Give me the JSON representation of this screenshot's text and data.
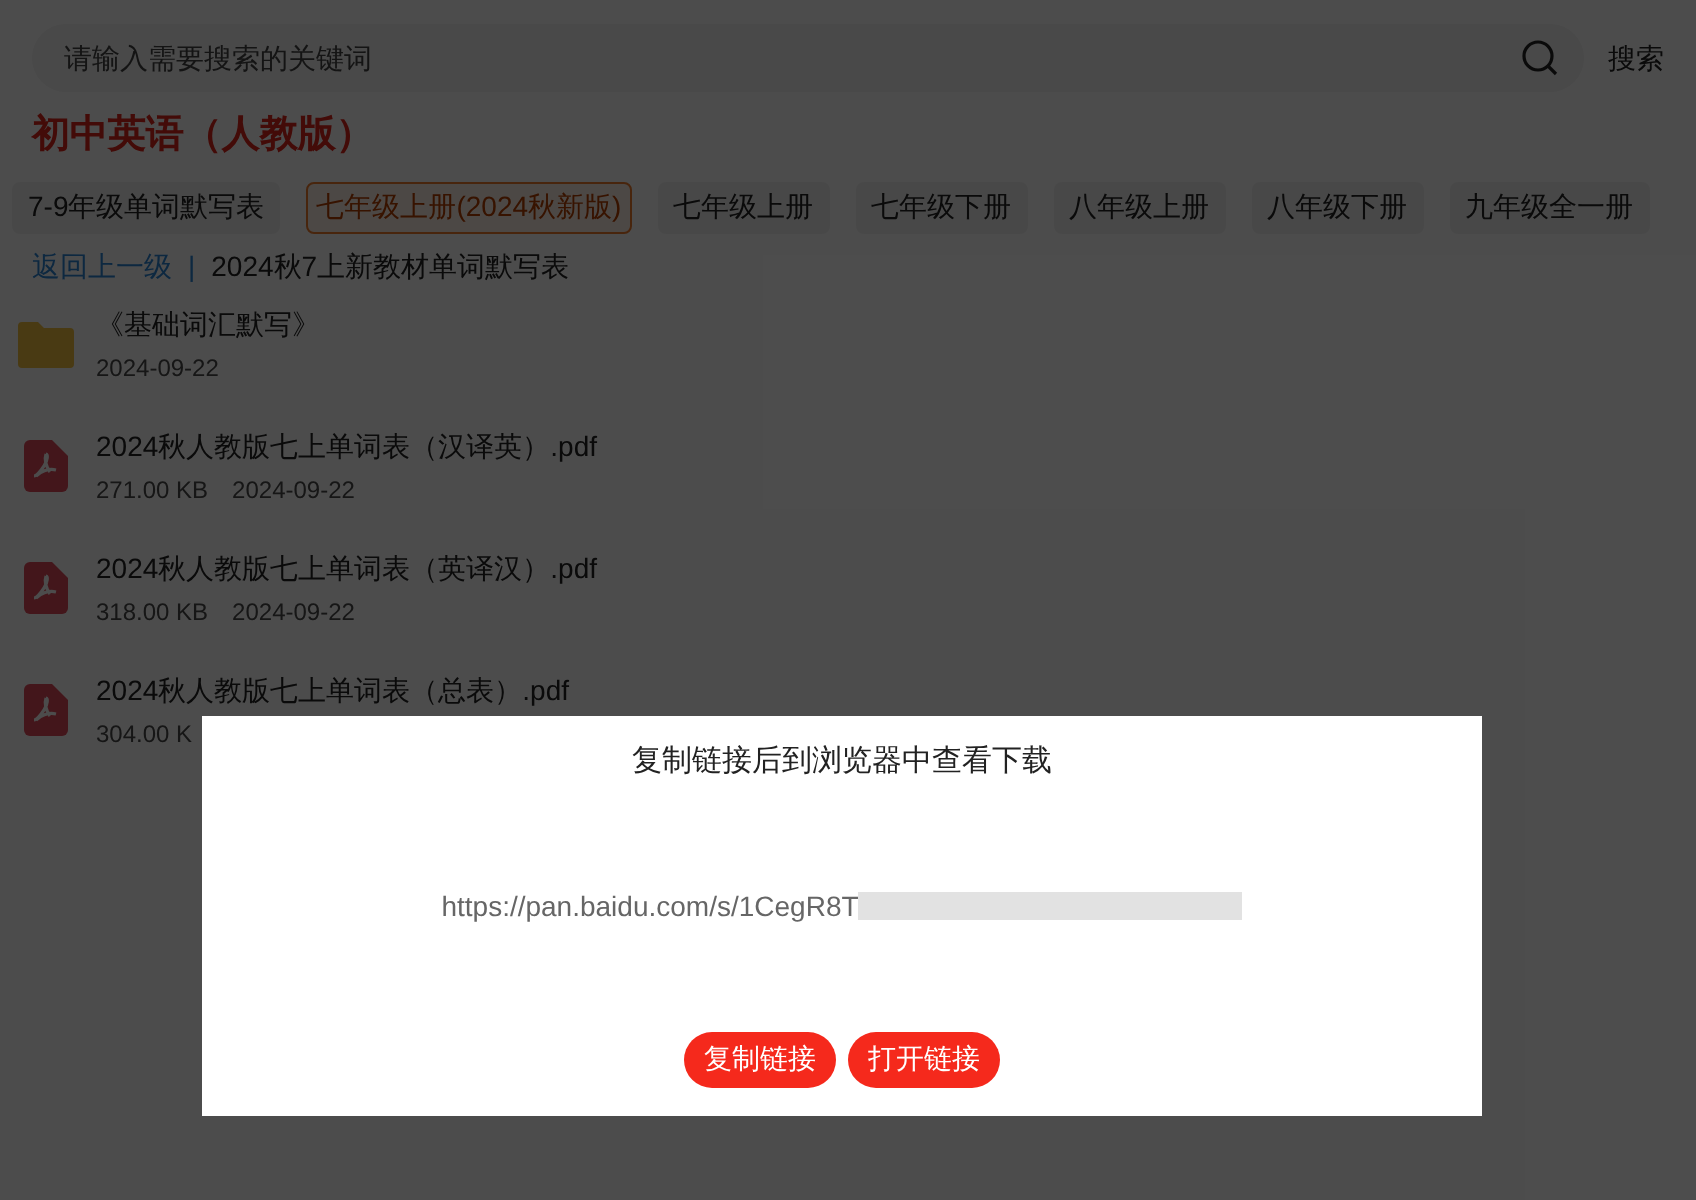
{
  "search": {
    "placeholder": "请输入需要搜索的关键词",
    "button": "搜索"
  },
  "heading": "初中英语（人教版）",
  "tabs": [
    {
      "label": "7-9年级单词默写表",
      "selected": false
    },
    {
      "label": "七年级上册(2024秋新版)",
      "selected": true
    },
    {
      "label": "七年级上册",
      "selected": false
    },
    {
      "label": "七年级下册",
      "selected": false
    },
    {
      "label": "八年级上册",
      "selected": false
    },
    {
      "label": "八年级下册",
      "selected": false
    },
    {
      "label": "九年级全一册",
      "selected": false
    }
  ],
  "breadcrumb": {
    "back": "返回上一级",
    "separator": "|",
    "current": "2024秋7上新教材单词默写表"
  },
  "files": [
    {
      "kind": "folder",
      "name": "《基础词汇默写》",
      "date": "2024-09-22"
    },
    {
      "kind": "pdf",
      "name": "2024秋人教版七上单词表（汉译英）.pdf",
      "size": "271.00 KB",
      "date": "2024-09-22"
    },
    {
      "kind": "pdf",
      "name": "2024秋人教版七上单词表（英译汉）.pdf",
      "size": "318.00 KB",
      "date": "2024-09-22"
    },
    {
      "kind": "pdf",
      "name": "2024秋人教版七上单词表（总表）.pdf",
      "size": "304.00 K"
    }
  ],
  "dialog": {
    "title": "复制链接后到浏览器中查看下载",
    "link": "https://pan.baidu.com/s/1CegR8T",
    "buttons": [
      "复制链接",
      "打开链接"
    ]
  }
}
